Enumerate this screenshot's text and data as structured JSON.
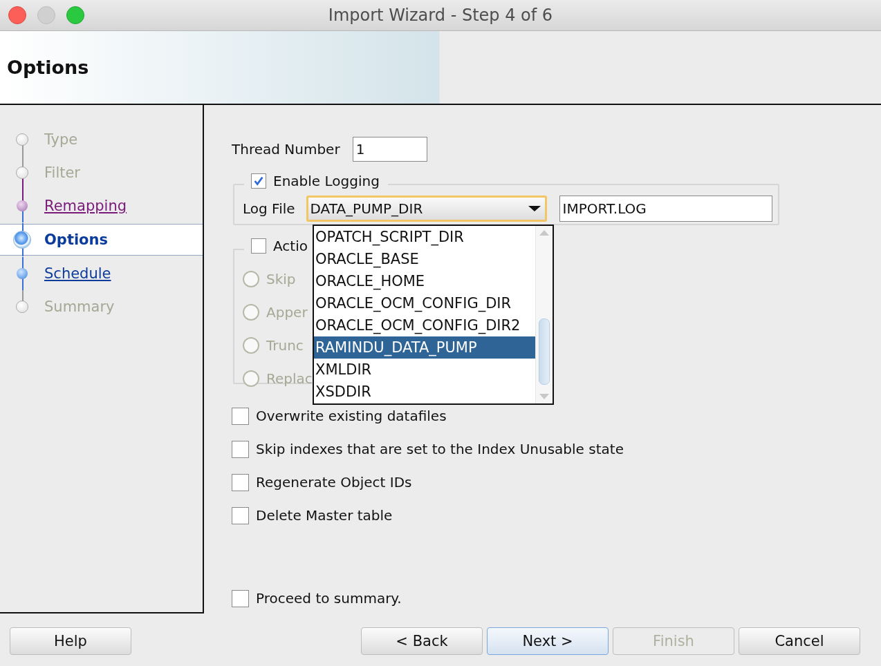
{
  "window": {
    "title": "Import Wizard - Step 4 of 6"
  },
  "header": {
    "title": "Options"
  },
  "steps": [
    {
      "label": "Type",
      "kind": "disabled",
      "selected": false
    },
    {
      "label": "Filter",
      "kind": "disabled",
      "selected": false
    },
    {
      "label": "Remapping",
      "kind": "visited",
      "selected": false
    },
    {
      "label": "Options",
      "kind": "current",
      "selected": true
    },
    {
      "label": "Schedule",
      "kind": "link",
      "selected": false
    },
    {
      "label": "Summary",
      "kind": "disabled",
      "selected": false
    }
  ],
  "thread_number": {
    "label": "Thread Number",
    "value": "1"
  },
  "logging": {
    "label": "Enable Logging",
    "checked": true,
    "log_file_label": "Log File",
    "directory": "DATA_PUMP_DIR",
    "file_name": "IMPORT.LOG"
  },
  "directory_list": [
    {
      "label": "OPATCH_SCRIPT_DIR",
      "selected": false
    },
    {
      "label": "ORACLE_BASE",
      "selected": false
    },
    {
      "label": "ORACLE_HOME",
      "selected": false
    },
    {
      "label": "ORACLE_OCM_CONFIG_DIR",
      "selected": false
    },
    {
      "label": "ORACLE_OCM_CONFIG_DIR2",
      "selected": false
    },
    {
      "label": "RAMINDU_DATA_PUMP",
      "selected": true
    },
    {
      "label": "XMLDIR",
      "selected": false
    },
    {
      "label": "XSDDIR",
      "selected": false
    }
  ],
  "action": {
    "label": "Actio",
    "checked": false,
    "options": [
      {
        "label": "Skip",
        "selected": false
      },
      {
        "label": "Apper",
        "selected": false
      },
      {
        "label": "Trunc",
        "selected": false
      },
      {
        "label": "Replac",
        "selected": false
      }
    ]
  },
  "checkboxes": [
    {
      "label": "Overwrite existing datafiles",
      "checked": false
    },
    {
      "label": "Skip indexes that are set to the Index Unusable state",
      "checked": false
    },
    {
      "label": "Regenerate Object IDs",
      "checked": false
    },
    {
      "label": "Delete Master table",
      "checked": false
    }
  ],
  "proceed": {
    "label": "Proceed to summary.",
    "checked": false
  },
  "buttons": [
    {
      "label": "Help",
      "kind": "plain",
      "disabled": false
    },
    {
      "label": "< Back",
      "kind": "plain",
      "disabled": false
    },
    {
      "label": "Next >",
      "kind": "default",
      "disabled": false
    },
    {
      "label": "Finish",
      "kind": "plain",
      "disabled": true
    },
    {
      "label": "Cancel",
      "kind": "plain",
      "disabled": false
    }
  ]
}
